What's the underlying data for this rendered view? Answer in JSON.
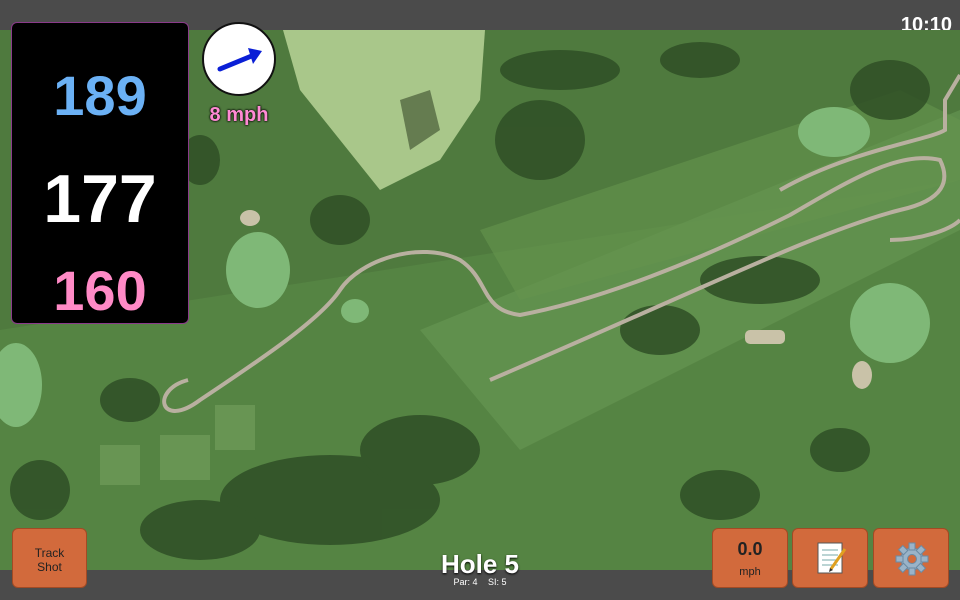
{
  "status_bar": {
    "time": "10:10"
  },
  "distances": {
    "back": "189",
    "middle": "177",
    "front": "160"
  },
  "wind": {
    "speed_label": "8 mph",
    "arrow_icon": "wind-direction-arrow-icon"
  },
  "hole": {
    "title": "Hole 5",
    "par_label": "Par: 4",
    "si_label": "SI: 5"
  },
  "buttons": {
    "track_shot_line1": "Track",
    "track_shot_line2": "Shot",
    "speed_value": "0.0",
    "speed_unit": "mph",
    "notes_icon": "notepad-icon",
    "settings_icon": "gear-icon"
  },
  "colors": {
    "back_distance": "#6bb1f5",
    "middle_distance": "#ffffff",
    "front_distance": "#ff8ac6",
    "button_bg": "#d26a3c",
    "wind_label": "#ff8ad4"
  }
}
